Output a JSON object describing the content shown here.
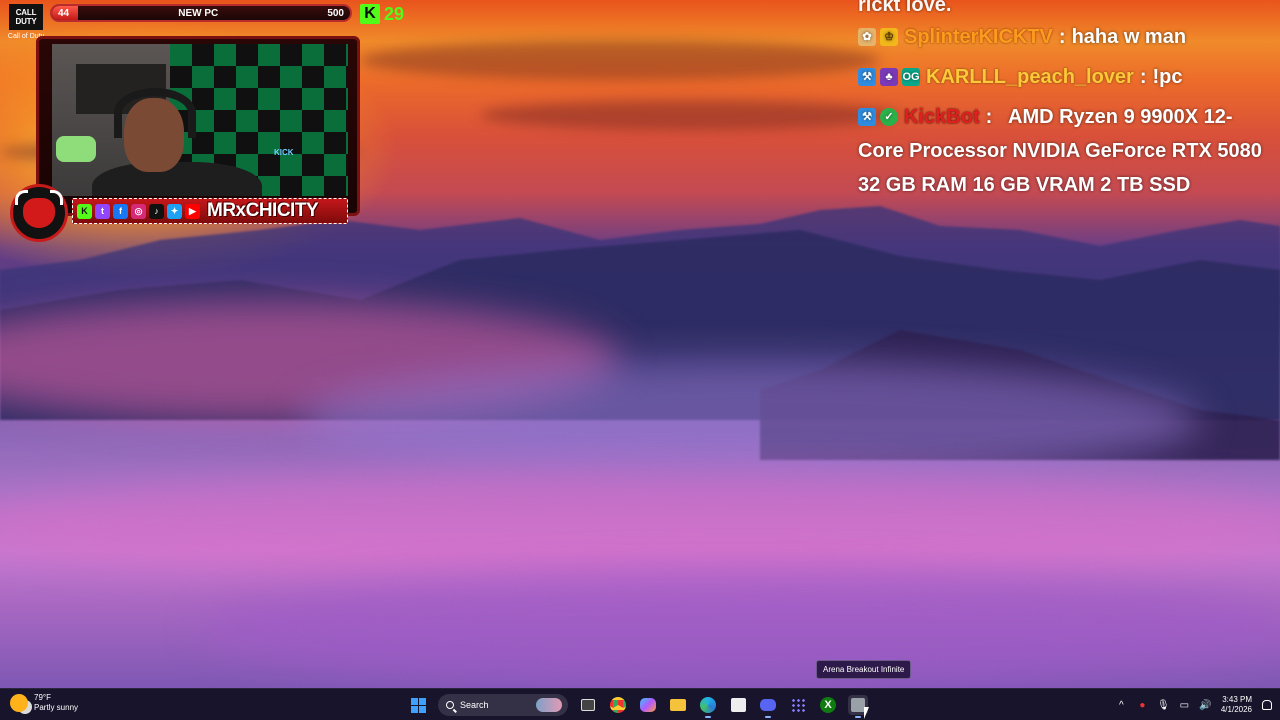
{
  "overlay": {
    "goal_bar": {
      "current": "44",
      "label": "NEW PC",
      "target": "500",
      "progress_fraction": 0.088
    },
    "kick_followers": {
      "count": "29"
    },
    "game_logo": {
      "line1": "CALL",
      "line2": "DUTY",
      "caption": "Call of Duty"
    },
    "streamer": {
      "name": "MRxCHICITY"
    }
  },
  "chat": {
    "cut_off_line": "rickt love.",
    "messages": [
      {
        "username": "SplinterKICKTV",
        "text": "haha w man",
        "color": "#ff9a1f"
      },
      {
        "username": "KARLLL_peach_lover",
        "text": "!pc",
        "color": "#ffc73a"
      },
      {
        "username": "KickBot",
        "text": "AMD Ryzen 9 9900X 12-Core Processor NVIDIA GeForce RTX 5080 32 GB RAM 16 GB VRAM 2 TB SSD",
        "color": "#e0201f"
      }
    ]
  },
  "tooltip": {
    "text": "Arena Breakout Infinite"
  },
  "taskbar": {
    "weather": {
      "temperature": "79°F",
      "condition": "Partly sunny"
    },
    "search": {
      "placeholder": "Search"
    },
    "clock": {
      "time": "3:43 PM",
      "date": "4/1/2026"
    },
    "apps": [
      "start-menu",
      "search",
      "task-view",
      "chrome",
      "copilot",
      "file-explorer",
      "edge",
      "microsoft-store",
      "discord",
      "app-grid",
      "xbox",
      "arena-breakout-infinite"
    ]
  },
  "colors": {
    "kick_green": "#53fc18",
    "overlay_red": "#c41818",
    "taskbar": "#16122a",
    "windows_blue": "#3ea1ff"
  }
}
